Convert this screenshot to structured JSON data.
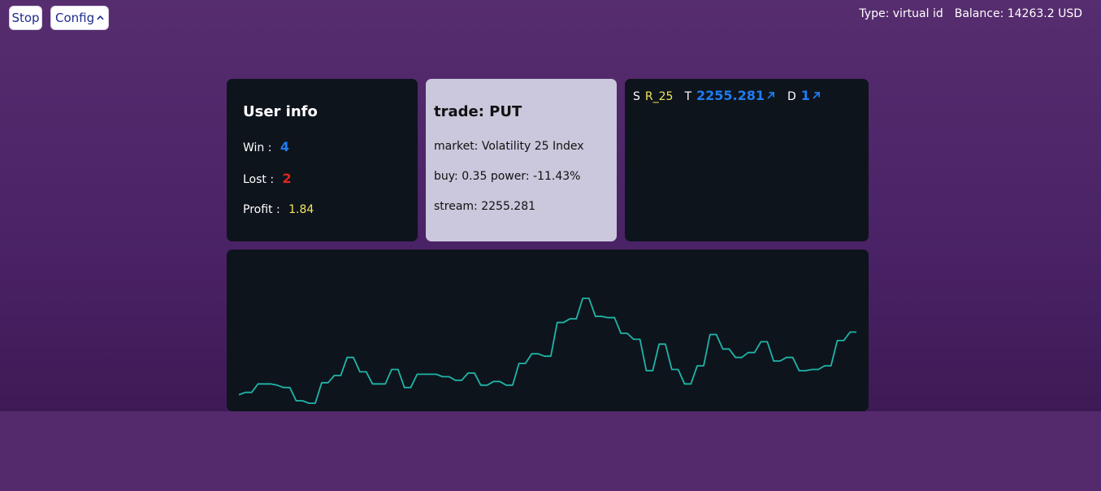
{
  "controls": {
    "stop_label": "Stop",
    "config_label": "Config"
  },
  "account": {
    "type_text": "Type: virtual id",
    "balance_text": "Balance: 14263.2 USD"
  },
  "user_info": {
    "title": "User info",
    "win_label": "Win :",
    "win_value": "4",
    "lost_label": "Lost :",
    "lost_value": "2",
    "profit_label": "Profit :",
    "profit_value": "1.84"
  },
  "trade": {
    "title": "trade: PUT",
    "market_text": "market: Volatility 25 Index",
    "buy_power_text": "buy: 0.35 power: -11.43%",
    "stream_text": "stream: 2255.281"
  },
  "ticker": {
    "s_label": "S",
    "symbol": "R_25",
    "t_label": "T",
    "t_value": "2255.281",
    "d_label": "D",
    "d_value": "1"
  },
  "colors": {
    "accent_blue": "#1f7cf0",
    "loss_red": "#e0251f",
    "profit_yellow": "#f2e65a",
    "line_teal": "#1fb5a8"
  },
  "chart_data": {
    "type": "line",
    "series": [
      {
        "values": [
          2249.2,
          2249.4,
          2249.4,
          2250.1,
          2250.1,
          2250.1,
          2250.0,
          2249.8,
          2249.8,
          2248.7,
          2248.7,
          2248.5,
          2248.5,
          2250.2,
          2250.2,
          2250.8,
          2250.8,
          2252.3,
          2252.3,
          2251.1,
          2251.1,
          2250.1,
          2250.1,
          2250.1,
          2251.3,
          2251.3,
          2249.8,
          2249.8,
          2250.9,
          2250.9,
          2250.9,
          2250.9,
          2250.7,
          2250.7,
          2250.4,
          2250.4,
          2251.0,
          2251.0,
          2250.0,
          2250.0,
          2250.3,
          2250.3,
          2250.0,
          2250.0,
          2251.8,
          2251.8,
          2252.6,
          2252.6,
          2252.4,
          2252.4,
          2255.2,
          2255.2,
          2255.5,
          2255.5,
          2257.2,
          2257.2,
          2255.7,
          2255.7,
          2255.6,
          2255.6,
          2254.3,
          2254.3,
          2253.8,
          2253.8,
          2251.2,
          2251.2,
          2253.4,
          2253.4,
          2251.3,
          2251.3,
          2250.1,
          2250.1,
          2251.6,
          2251.6,
          2254.2,
          2254.2,
          2253.0,
          2253.0,
          2252.3,
          2252.3,
          2252.7,
          2252.7,
          2253.6,
          2253.6,
          2252.0,
          2252.0,
          2252.3,
          2252.3,
          2251.2,
          2251.2,
          2251.3,
          2251.3,
          2251.6,
          2251.6,
          2253.7,
          2253.7,
          2254.4,
          2254.4
        ]
      }
    ]
  }
}
